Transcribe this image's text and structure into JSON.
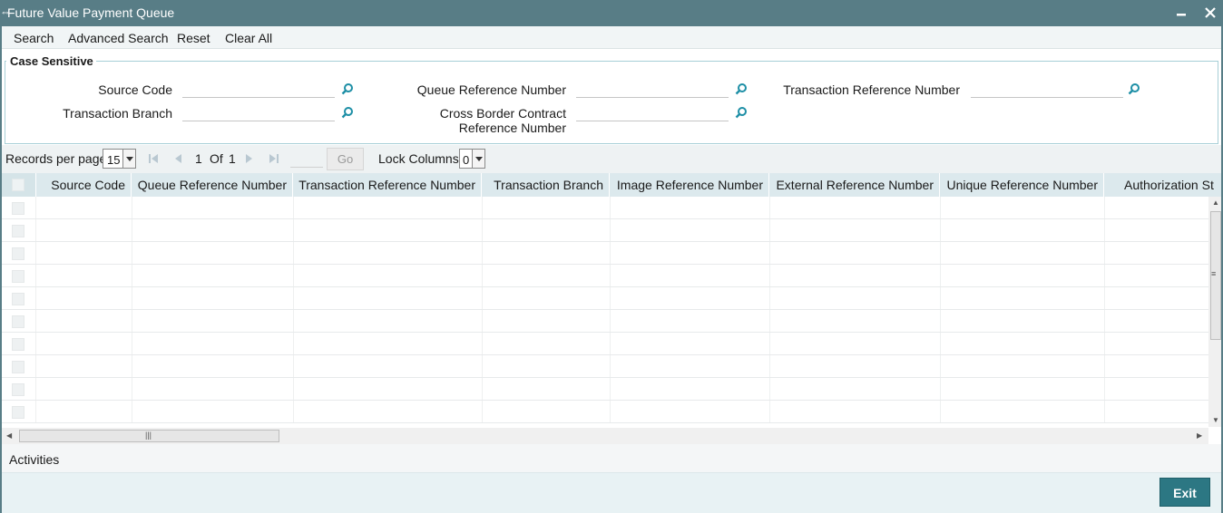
{
  "window": {
    "title": "Future Value Payment Queue",
    "minimize_glyph": "▬",
    "close_glyph": "✕"
  },
  "menu": {
    "search": "Search",
    "advanced_search": "Advanced Search",
    "reset": "Reset",
    "clear_all": "Clear All"
  },
  "criteria": {
    "legend": "Case Sensitive",
    "fields": {
      "source_code": {
        "label": "Source Code",
        "value": ""
      },
      "queue_reference_number": {
        "label": "Queue Reference Number",
        "value": ""
      },
      "transaction_reference_number": {
        "label": "Transaction Reference Number",
        "value": ""
      },
      "transaction_branch": {
        "label": "Transaction Branch",
        "value": ""
      },
      "cross_border_contract_reference_number": {
        "label_line1": "Cross Border Contract",
        "label_line2": "Reference Number",
        "value": ""
      }
    }
  },
  "pager": {
    "records_per_page_label": "Records per page",
    "records_per_page_value": "15",
    "current_page": "1",
    "of_label": "Of",
    "total_pages": "1",
    "goto_value": "",
    "go_label": "Go",
    "lock_columns_label": "Lock Columns",
    "lock_columns_value": "0"
  },
  "grid": {
    "columns": [
      "Source Code",
      "Queue Reference Number",
      "Transaction Reference Number",
      "Transaction Branch",
      "Image Reference Number",
      "External Reference Number",
      "Unique Reference Number",
      "Authorization St"
    ],
    "rows": [
      [],
      [],
      [],
      [],
      [],
      [],
      [],
      [],
      [],
      []
    ]
  },
  "activities": {
    "label": "Activities"
  },
  "footer": {
    "exit_label": "Exit"
  },
  "colors": {
    "titlebar": "#587d86",
    "accent_button": "#2c7783",
    "lookup_icon": "#1e8fa6",
    "grid_header": "#dce9ed"
  },
  "icons": {
    "lookup": "magnifier-icon",
    "first_page": "first-page-icon",
    "prev_page": "prev-page-icon",
    "next_page": "next-page-icon",
    "last_page": "last-page-icon"
  }
}
